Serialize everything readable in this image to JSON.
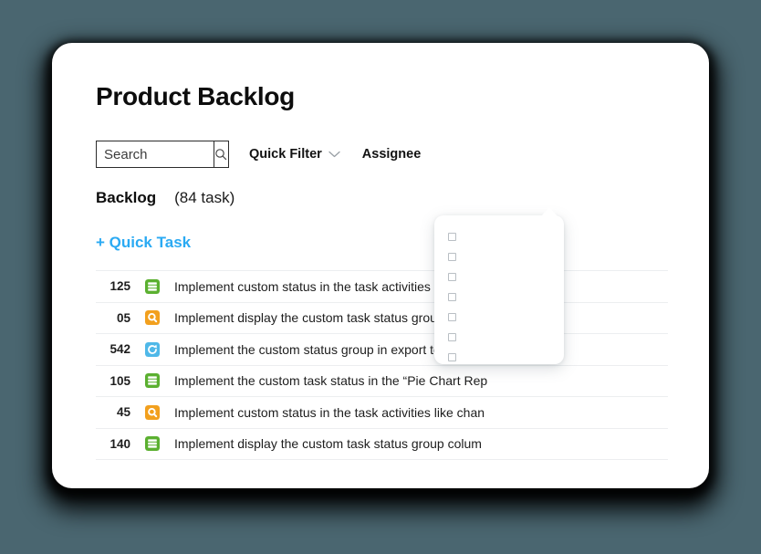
{
  "background_color": "#4a6670",
  "card": {
    "title": "Product Backlog"
  },
  "toolbar": {
    "search": {
      "value": "Search",
      "placeholder": "Search",
      "icon": "search-icon"
    },
    "quick_filter": {
      "label": "Quick Filter",
      "icon": "chevron-down-icon"
    },
    "assignee": {
      "label": "Assignee"
    }
  },
  "section": {
    "label": "Backlog",
    "count_text": "(84 task)"
  },
  "quick_task": {
    "label": "+ Quick Task"
  },
  "assignee_dropdown": {
    "visible": true,
    "options": [
      {
        "label": "",
        "checked": false
      },
      {
        "label": "",
        "checked": false
      },
      {
        "label": "",
        "checked": false
      },
      {
        "label": "",
        "checked": false
      },
      {
        "label": "",
        "checked": false
      },
      {
        "label": "",
        "checked": false
      },
      {
        "label": "",
        "checked": false
      }
    ]
  },
  "task_list": {
    "rows": [
      {
        "id": "125",
        "title": "Implement custom status in the task activities like",
        "icon": "task-stack-icon",
        "icon_color": "#5bb030"
      },
      {
        "id": "05",
        "title": "Implement display the custom task status group colum",
        "icon": "task-query-icon",
        "icon_color": "#f2a01e"
      },
      {
        "id": "542",
        "title": "Implement the custom status group in export to pdf ...",
        "icon": "task-refresh-icon",
        "icon_color": "#4fb8e8"
      },
      {
        "id": "105",
        "title": "Implement the custom task status in the “Pie Chart Rep",
        "icon": "task-stack-icon",
        "icon_color": "#5bb030"
      },
      {
        "id": "45",
        "title": "Implement custom status in the task activities like chan",
        "icon": "task-query-icon",
        "icon_color": "#f2a01e"
      },
      {
        "id": "140",
        "title": "Implement display the custom task status group colum",
        "icon": "task-stack-icon",
        "icon_color": "#5bb030"
      }
    ]
  }
}
